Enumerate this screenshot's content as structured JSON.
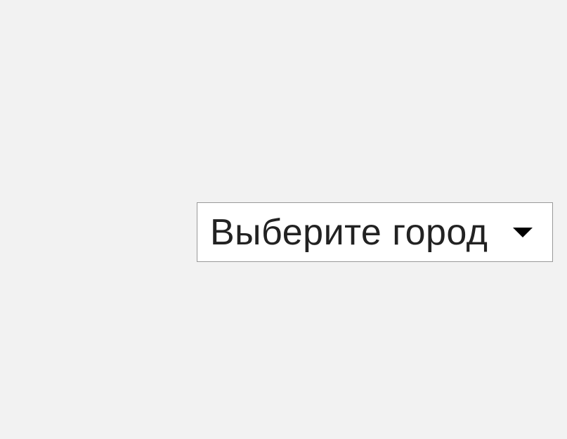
{
  "city_selector": {
    "placeholder_label": "Выберите город"
  }
}
